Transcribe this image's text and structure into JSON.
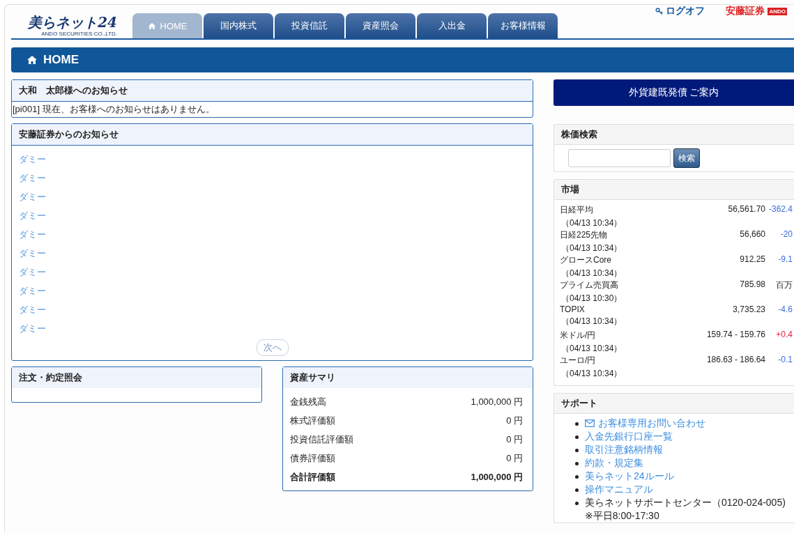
{
  "header": {
    "logo": "美らネット24",
    "logo_sub": "ANDO SECURITIES CO.,LTD.",
    "logoff": "ログオフ",
    "brand": "安藤証券",
    "brand_badge": "ANDO"
  },
  "tabs": [
    {
      "label": "HOME",
      "selected": true,
      "kind": "home"
    },
    {
      "label": "国内株式",
      "selected": false
    },
    {
      "label": "投資信託",
      "selected": false
    },
    {
      "label": "資産照会",
      "selected": false
    },
    {
      "label": "入出金",
      "selected": false
    },
    {
      "label": "お客様情報",
      "selected": false
    }
  ],
  "page_title": "HOME",
  "personal_notice": {
    "title": "大和　太郎様へのお知らせ",
    "message": "[pi001] 現在、お客様へのお知らせはありません。"
  },
  "ando_notices": {
    "title": "安藤証券からのお知らせ",
    "items": [
      "ダミー",
      "ダミー",
      "ダミー",
      "ダミー",
      "ダミー",
      "ダミー",
      "ダミー",
      "ダミー",
      "ダミー",
      "ダミー"
    ],
    "next": "次へ"
  },
  "orders": {
    "title": "注文・約定照会"
  },
  "asset_summary": {
    "title": "資産サマリ",
    "rows": [
      {
        "label": "金銭残高",
        "value": "1,000,000 円",
        "total": false
      },
      {
        "label": "株式評価額",
        "value": "0 円",
        "total": false
      },
      {
        "label": "投資信託評価額",
        "value": "0 円",
        "total": false
      },
      {
        "label": "債券評価額",
        "value": "0 円",
        "total": false
      },
      {
        "label": "合計評価額",
        "value": "1,000,000 円",
        "total": true
      }
    ]
  },
  "bond_banner": "外貨建既発債 ご案内",
  "stock_search": {
    "title": "株価検索",
    "button": "検索"
  },
  "market": {
    "title": "市場",
    "rows": [
      {
        "name": "日経平均",
        "time": "（04/13 10:34）",
        "value": "56,561.70",
        "change": "-362.4",
        "color": "#3b6de0"
      },
      {
        "name": "日経225先物",
        "time": "（04/13 10:34）",
        "value": "56,660",
        "change": "-20",
        "color": "#3b6de0"
      },
      {
        "name": "グロースCore",
        "time": "（04/13 10:34）",
        "value": "912.25",
        "change": "-9.1",
        "color": "#3b6de0"
      },
      {
        "name": "プライム売買高",
        "time": "（04/13 10:30）",
        "value": "785.98",
        "change": "百万"
      },
      {
        "name": "TOPIX",
        "time": "（04/13 10:34）",
        "value": "3,735.23",
        "change": "-4.6",
        "color": "#3b6de0"
      },
      {
        "name": "米ドル/円",
        "time": "（04/13 10:34）",
        "value": "159.74 - 159.76",
        "change": "+0.4",
        "color": "#e02040"
      },
      {
        "name": "ユーロ/円",
        "time": "（04/13 10:34）",
        "value": "186.63 - 186.64",
        "change": "-0.1",
        "color": "#3b6de0"
      }
    ]
  },
  "support": {
    "title": "サポート",
    "links": [
      {
        "label": "お客様専用お問い合わせ",
        "kind": "mail"
      },
      {
        "label": "入金先銀行口座一覧",
        "kind": "link"
      },
      {
        "label": "取引注意銘柄情報",
        "kind": "link"
      },
      {
        "label": "約款・規定集",
        "kind": "link"
      },
      {
        "label": "美らネット24ルール",
        "kind": "link"
      },
      {
        "label": "操作マニュアル",
        "kind": "link"
      },
      {
        "label": "美らネットサポートセンター（0120-024-005)",
        "kind": "text",
        "note": "※平日8:00-17:30"
      }
    ]
  }
}
